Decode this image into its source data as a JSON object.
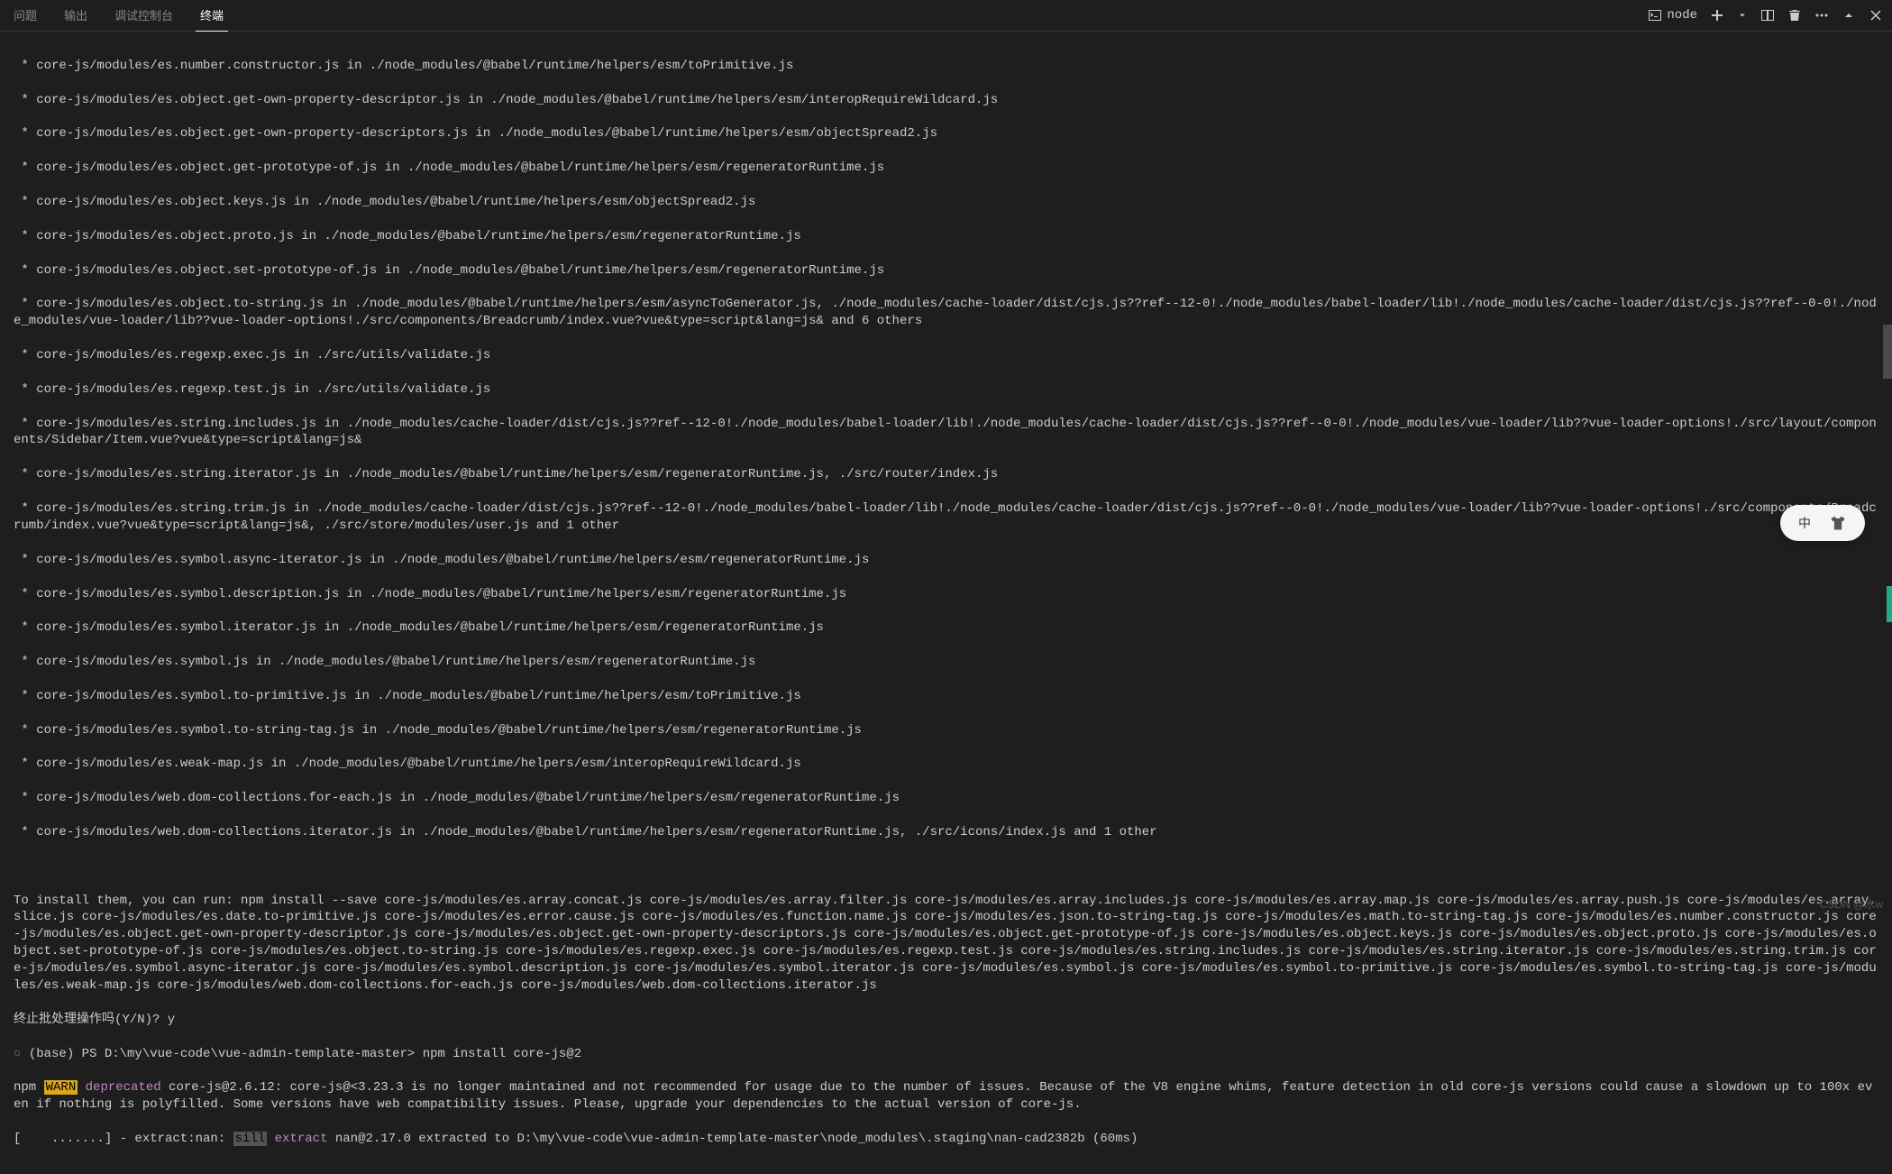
{
  "tabs": {
    "problems": "问题",
    "output": "输出",
    "debug": "调试控制台",
    "terminal": "终端"
  },
  "toolbar": {
    "shell": "node"
  },
  "terminal": {
    "lines": [
      " * core-js/modules/es.number.constructor.js in ./node_modules/@babel/runtime/helpers/esm/toPrimitive.js",
      " * core-js/modules/es.object.get-own-property-descriptor.js in ./node_modules/@babel/runtime/helpers/esm/interopRequireWildcard.js",
      " * core-js/modules/es.object.get-own-property-descriptors.js in ./node_modules/@babel/runtime/helpers/esm/objectSpread2.js",
      " * core-js/modules/es.object.get-prototype-of.js in ./node_modules/@babel/runtime/helpers/esm/regeneratorRuntime.js",
      " * core-js/modules/es.object.keys.js in ./node_modules/@babel/runtime/helpers/esm/objectSpread2.js",
      " * core-js/modules/es.object.proto.js in ./node_modules/@babel/runtime/helpers/esm/regeneratorRuntime.js",
      " * core-js/modules/es.object.set-prototype-of.js in ./node_modules/@babel/runtime/helpers/esm/regeneratorRuntime.js",
      " * core-js/modules/es.object.to-string.js in ./node_modules/@babel/runtime/helpers/esm/asyncToGenerator.js, ./node_modules/cache-loader/dist/cjs.js??ref--12-0!./node_modules/babel-loader/lib!./node_modules/cache-loader/dist/cjs.js??ref--0-0!./node_modules/vue-loader/lib??vue-loader-options!./src/components/Breadcrumb/index.vue?vue&type=script&lang=js& and 6 others",
      " * core-js/modules/es.regexp.exec.js in ./src/utils/validate.js",
      " * core-js/modules/es.regexp.test.js in ./src/utils/validate.js",
      " * core-js/modules/es.string.includes.js in ./node_modules/cache-loader/dist/cjs.js??ref--12-0!./node_modules/babel-loader/lib!./node_modules/cache-loader/dist/cjs.js??ref--0-0!./node_modules/vue-loader/lib??vue-loader-options!./src/layout/components/Sidebar/Item.vue?vue&type=script&lang=js&",
      " * core-js/modules/es.string.iterator.js in ./node_modules/@babel/runtime/helpers/esm/regeneratorRuntime.js, ./src/router/index.js",
      " * core-js/modules/es.string.trim.js in ./node_modules/cache-loader/dist/cjs.js??ref--12-0!./node_modules/babel-loader/lib!./node_modules/cache-loader/dist/cjs.js??ref--0-0!./node_modules/vue-loader/lib??vue-loader-options!./src/components/Breadcrumb/index.vue?vue&type=script&lang=js&, ./src/store/modules/user.js and 1 other",
      " * core-js/modules/es.symbol.async-iterator.js in ./node_modules/@babel/runtime/helpers/esm/regeneratorRuntime.js",
      " * core-js/modules/es.symbol.description.js in ./node_modules/@babel/runtime/helpers/esm/regeneratorRuntime.js",
      " * core-js/modules/es.symbol.iterator.js in ./node_modules/@babel/runtime/helpers/esm/regeneratorRuntime.js",
      " * core-js/modules/es.symbol.js in ./node_modules/@babel/runtime/helpers/esm/regeneratorRuntime.js",
      " * core-js/modules/es.symbol.to-primitive.js in ./node_modules/@babel/runtime/helpers/esm/toPrimitive.js",
      " * core-js/modules/es.symbol.to-string-tag.js in ./node_modules/@babel/runtime/helpers/esm/regeneratorRuntime.js",
      " * core-js/modules/es.weak-map.js in ./node_modules/@babel/runtime/helpers/esm/interopRequireWildcard.js",
      " * core-js/modules/web.dom-collections.for-each.js in ./node_modules/@babel/runtime/helpers/esm/regeneratorRuntime.js",
      " * core-js/modules/web.dom-collections.iterator.js in ./node_modules/@babel/runtime/helpers/esm/regeneratorRuntime.js, ./src/icons/index.js and 1 other"
    ],
    "install_hint": "To install them, you can run: npm install --save core-js/modules/es.array.concat.js core-js/modules/es.array.filter.js core-js/modules/es.array.includes.js core-js/modules/es.array.map.js core-js/modules/es.array.push.js core-js/modules/es.array.slice.js core-js/modules/es.date.to-primitive.js core-js/modules/es.error.cause.js core-js/modules/es.function.name.js core-js/modules/es.json.to-string-tag.js core-js/modules/es.math.to-string-tag.js core-js/modules/es.number.constructor.js core-js/modules/es.object.get-own-property-descriptor.js core-js/modules/es.object.get-own-property-descriptors.js core-js/modules/es.object.get-prototype-of.js core-js/modules/es.object.keys.js core-js/modules/es.object.proto.js core-js/modules/es.object.set-prototype-of.js core-js/modules/es.object.to-string.js core-js/modules/es.regexp.exec.js core-js/modules/es.regexp.test.js core-js/modules/es.string.includes.js core-js/modules/es.string.iterator.js core-js/modules/es.string.trim.js core-js/modules/es.symbol.async-iterator.js core-js/modules/es.symbol.description.js core-js/modules/es.symbol.iterator.js core-js/modules/es.symbol.js core-js/modules/es.symbol.to-primitive.js core-js/modules/es.symbol.to-string-tag.js core-js/modules/es.weak-map.js core-js/modules/web.dom-collections.for-each.js core-js/modules/web.dom-collections.iterator.js",
    "batch_prompt": "终止批处理操作吗(Y/N)? y",
    "prompt_prefix": "(base) PS D:\\my\\vue-code\\vue-admin-template-master> ",
    "command": "npm install core-js@2",
    "npm_label": "npm",
    "warn_label": "WARN",
    "deprecated_label": "deprecated",
    "warn_text": " core-js@2.6.12: core-js@<3.23.3 is no longer maintained and not recommended for usage due to the number of issues. Because of the V8 engine whims, feature detection in old core-js versions could cause a slowdown up to 100x even if nothing is polyfilled. Some versions have web compatibility issues. Please, upgrade your dependencies to the actual version of core-js.",
    "progress_prefix": "[    .......] - extract:nan: ",
    "sill_label": "sill",
    "extract_label": "extract",
    "progress_text": " nan@2.17.0 extracted to D:\\my\\vue-code\\vue-admin-template-master\\node_modules\\.staging\\nan-cad2382b (60ms)"
  },
  "floating": {
    "label": "中"
  },
  "watermark": "CSDN @水w"
}
